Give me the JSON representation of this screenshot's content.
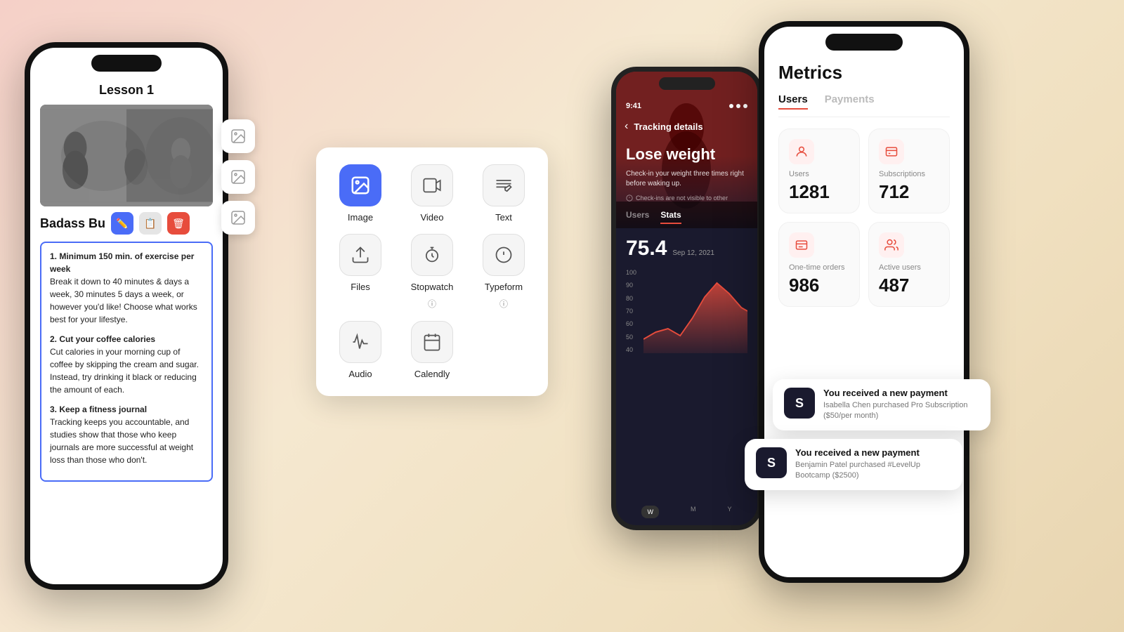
{
  "background": {
    "gradient": "linear-gradient(135deg, #f5d0c8, #f5e8d0, #e8d5b0)"
  },
  "phone1": {
    "lesson_title": "Lesson 1",
    "item_title": "Badass Bu",
    "list_items": [
      {
        "heading": "1. Minimum 150 min. of exercise per week",
        "body": "Break it down to 40 minutes & days a week, 30 minutes 5 days a week, or however you'd like! Choose what works best for your lifestye."
      },
      {
        "heading": "2. Cut your coffee calories",
        "body": "Cut calories in your morning cup of coffee by skipping the cream and sugar. Instead, try drinking it black or reducing the amount of each."
      },
      {
        "heading": "3. Keep a fitness journal",
        "body": "Tracking keeps you accountable, and studies show that those who keep journals are more successful at weight loss than those who don't."
      }
    ]
  },
  "content_menu": {
    "items": [
      {
        "label": "Image",
        "type": "primary",
        "icon": "image-icon"
      },
      {
        "label": "Video",
        "type": "secondary",
        "icon": "video-icon"
      },
      {
        "label": "Text",
        "type": "secondary",
        "icon": "text-icon"
      },
      {
        "label": "Files",
        "type": "secondary",
        "icon": "files-icon"
      },
      {
        "label": "Stopwatch",
        "type": "secondary",
        "icon": "stopwatch-icon",
        "has_info": true
      },
      {
        "label": "Typeform",
        "type": "secondary",
        "icon": "typeform-icon",
        "has_info": true
      },
      {
        "label": "Audio",
        "type": "secondary",
        "icon": "audio-icon"
      },
      {
        "label": "Calendly",
        "type": "secondary",
        "icon": "calendly-icon"
      }
    ]
  },
  "phone2": {
    "time": "9:41",
    "nav_title": "Tracking details",
    "hero_title": "Lose weight",
    "hero_desc": "Check-in your weight three times right before waking up.",
    "checkin_note": "Check-ins are not visible to other",
    "tabs": [
      "Users",
      "Stats"
    ],
    "active_tab": "Stats",
    "big_number": "75.4",
    "date": "Sep 12, 2021",
    "chart_labels": [
      "100",
      "90",
      "80",
      "70",
      "60",
      "50",
      "40"
    ],
    "bottom_tabs": [
      "W",
      "M",
      "Y"
    ]
  },
  "phone3": {
    "page_title": "Metrics",
    "tabs": [
      "Users",
      "Payments"
    ],
    "active_tab": "Users",
    "metrics": [
      {
        "label": "Users",
        "value": "1281",
        "icon": "user-icon"
      },
      {
        "label": "Subscriptions",
        "value": "712",
        "icon": "subscription-icon"
      },
      {
        "label": "One-time orders",
        "value": "986",
        "icon": "orders-icon"
      },
      {
        "label": "Active users",
        "value": "487",
        "icon": "active-icon"
      }
    ]
  },
  "payment_notifications": [
    {
      "title": "You received a new payment",
      "desc": "Isabella Chen purchased Pro Subscription ($50/per month)"
    },
    {
      "title": "You received a new payment",
      "desc": "Benjamin Patel purchased #LevelUp Bootcamp ($2500)"
    }
  ]
}
